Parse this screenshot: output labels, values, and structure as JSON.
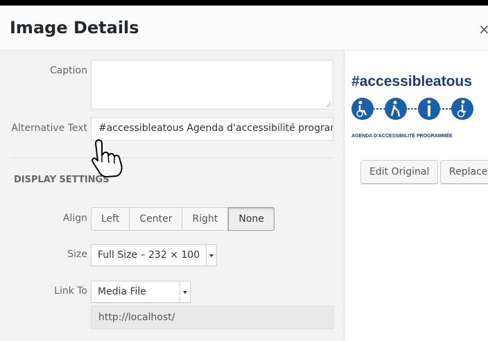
{
  "dialog": {
    "title": "Image Details",
    "close_glyph": "×"
  },
  "fields": {
    "caption_label": "Caption",
    "caption_value": "",
    "alt_label": "Alternative Text",
    "alt_value": "#accessibleatous Agenda d'accessibilité programmée"
  },
  "display_settings": {
    "heading": "DISPLAY SETTINGS",
    "align_label": "Align",
    "align_options": [
      "Left",
      "Center",
      "Right",
      "None"
    ],
    "align_selected": "None",
    "size_label": "Size",
    "size_value": "Full Size – 232 × 100",
    "link_label": "Link To",
    "link_value": "Media File",
    "link_url": "http://localhost/"
  },
  "preview": {
    "title": "#accessibleatous",
    "subtitle": "AGENDA D'ACCESSIBILITÉ PROGRAMMÉE",
    "icons": [
      "wheelchair-icon",
      "elderly-person-icon",
      "information-person-icon",
      "accessible-icon"
    ],
    "accent_color": "#1a5fa8",
    "text_color": "#1f3c6e"
  },
  "actions": {
    "edit_original": "Edit Original",
    "replace": "Replace"
  }
}
